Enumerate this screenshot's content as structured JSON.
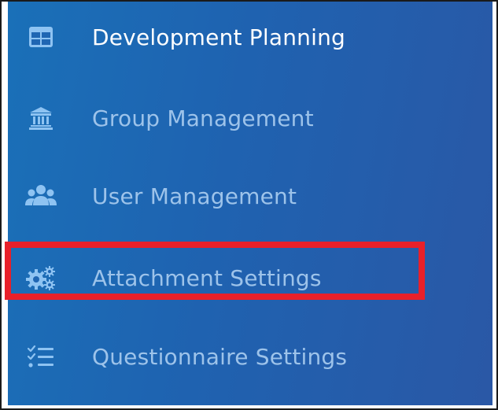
{
  "sidebar": {
    "items": [
      {
        "label": "Development Planning",
        "icon": "grid-table-icon",
        "state": "active"
      },
      {
        "label": "Group Management",
        "icon": "institution-icon",
        "state": "default"
      },
      {
        "label": "User Management",
        "icon": "users-icon",
        "state": "default"
      },
      {
        "label": "Attachment Settings",
        "icon": "cogs-icon",
        "state": "highlighted"
      },
      {
        "label": "Questionnaire Settings",
        "icon": "checklist-icon",
        "state": "default"
      }
    ]
  },
  "colors": {
    "sidebar_start": "#1a70b8",
    "sidebar_end": "#2a58a6",
    "active_text": "#ffffff",
    "muted_text": "#9dc3ea",
    "icon_color": "#8ec3f2",
    "highlight": "#e8202a"
  }
}
